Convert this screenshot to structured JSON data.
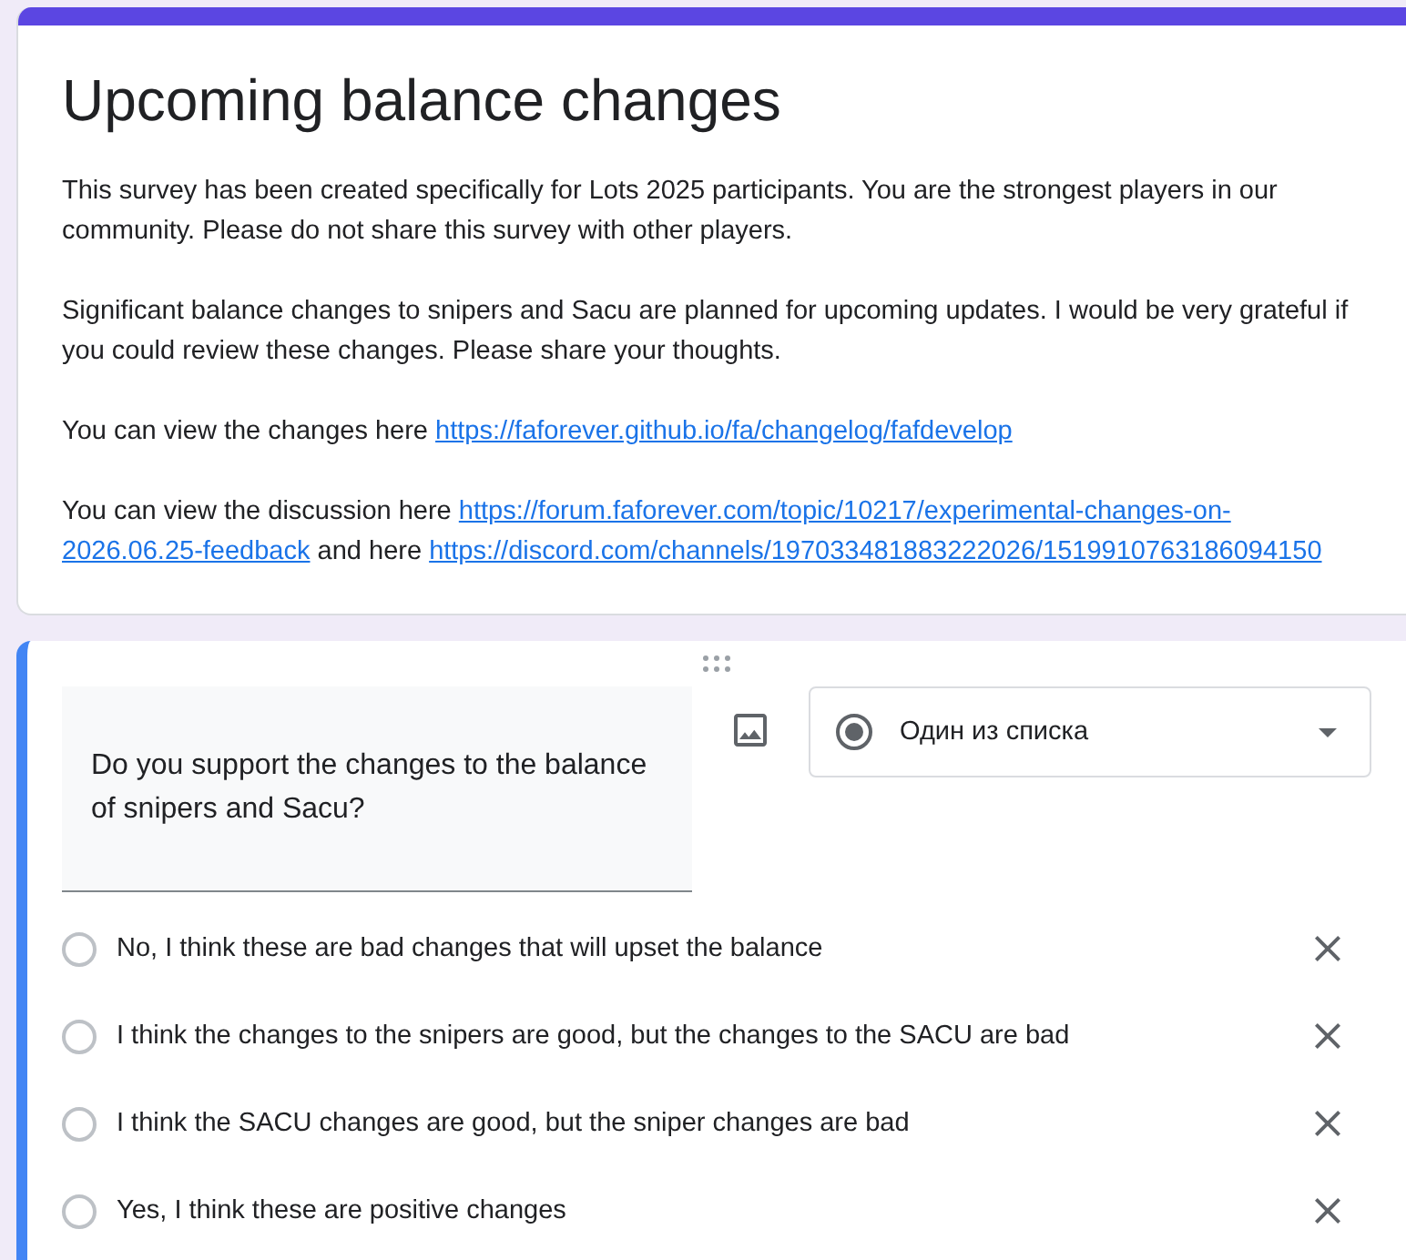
{
  "header": {
    "title": "Upcoming balance changes",
    "paragraphs": [
      {
        "segments": [
          {
            "kind": "text",
            "text": "This survey has been created specifically for Lots 2025 participants. You are the strongest players in our community. Please do not share this survey with other players."
          }
        ]
      },
      {
        "segments": [
          {
            "kind": "text",
            "text": "Significant balance changes to snipers and Sacu are planned for upcoming updates. I would be very grateful if you could review these changes. Please share your thoughts."
          }
        ]
      },
      {
        "segments": [
          {
            "kind": "text",
            "text": "You can view the changes here "
          },
          {
            "kind": "link",
            "text": "https://faforever.github.io/fa/changelog/fafdevelop"
          }
        ]
      },
      {
        "segments": [
          {
            "kind": "text",
            "text": "You can view the discussion here  "
          },
          {
            "kind": "link",
            "text": "https://forum.faforever.com/topic/10217/experimental-changes-on-"
          },
          {
            "kind": "link",
            "text": "2026.06.25-feedback"
          },
          {
            "kind": "text",
            "text": " and here "
          },
          {
            "kind": "link",
            "text": "https://discord.com/channels/197033481883222026/1519910763186094150"
          }
        ]
      }
    ]
  },
  "question": {
    "title": "Do you support the changes to the balance of snipers and Sacu?",
    "type_dropdown": {
      "label": "Один из списка"
    },
    "options": [
      {
        "label": "No, I think these are bad changes that will upset the balance",
        "selected": false
      },
      {
        "label": "I think the changes to the snipers are good, but the changes to the SACU are bad",
        "selected": false
      },
      {
        "label": "I think the SACU changes are good, but the sniper changes are bad",
        "selected": false
      },
      {
        "label": "Yes, I think these are positive changes",
        "selected": false
      }
    ]
  }
}
